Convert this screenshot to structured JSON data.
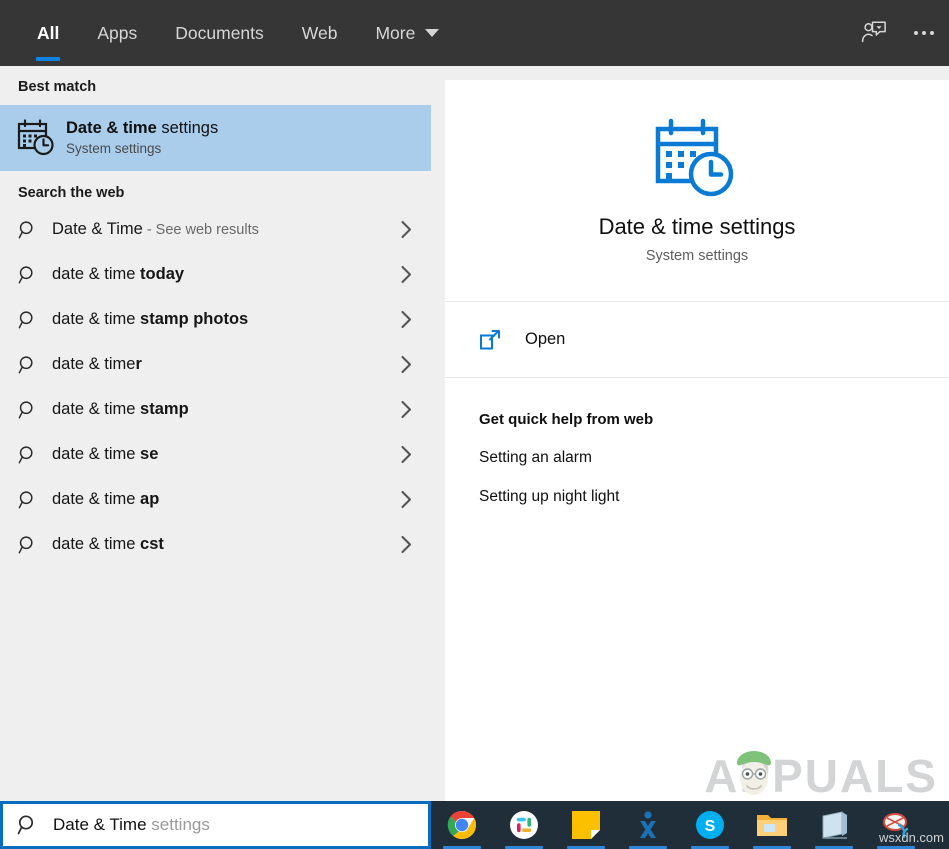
{
  "topbar": {
    "tabs": [
      {
        "label": "All",
        "active": true,
        "caret": false
      },
      {
        "label": "Apps",
        "active": false,
        "caret": false
      },
      {
        "label": "Documents",
        "active": false,
        "caret": false
      },
      {
        "label": "Web",
        "active": false,
        "caret": false
      },
      {
        "label": "More",
        "active": false,
        "caret": true
      }
    ],
    "feedback_icon": "feedback-person-icon",
    "overflow_icon": "ellipsis-icon",
    "accent_color": "#0a84e0",
    "background_color": "#363636"
  },
  "left_panel": {
    "best_match_heading": "Best match",
    "best_match": {
      "title_bold": "Date & time",
      "title_rest": " settings",
      "subtitle": "System settings",
      "icon": "calendar-clock-icon",
      "highlight_color": "#a9cdeb"
    },
    "web_heading": "Search the web",
    "suggestions": [
      {
        "prefix": "Date & Time",
        "bold": "",
        "suffix_muted": " - See web results"
      },
      {
        "prefix": "date & time ",
        "bold": "today",
        "suffix_muted": ""
      },
      {
        "prefix": "date & time ",
        "bold": "stamp photos",
        "suffix_muted": ""
      },
      {
        "prefix": "date & time",
        "bold": "r",
        "suffix_muted": ""
      },
      {
        "prefix": "date & time ",
        "bold": "stamp",
        "suffix_muted": ""
      },
      {
        "prefix": "date & time ",
        "bold": "se",
        "suffix_muted": ""
      },
      {
        "prefix": "date & time ",
        "bold": "ap",
        "suffix_muted": ""
      },
      {
        "prefix": "date & time ",
        "bold": "cst",
        "suffix_muted": ""
      }
    ]
  },
  "preview": {
    "icon": "calendar-clock-icon-large",
    "icon_color": "#0a7bd4",
    "title": "Date & time settings",
    "subtitle": "System settings",
    "open_action": {
      "label": "Open",
      "icon": "open-external-icon"
    },
    "help_title": "Get quick help from web",
    "help_links": [
      "Setting an alarm",
      "Setting up night light"
    ]
  },
  "search": {
    "typed_text": "Date & Time",
    "ghost_text": " settings",
    "icon": "search-icon",
    "border_color": "#0a6cbd"
  },
  "taskbar": {
    "background_color": "#1f2e38",
    "items": [
      {
        "name": "chrome",
        "running": true
      },
      {
        "name": "slack",
        "running": true
      },
      {
        "name": "sticky-notes",
        "running": true
      },
      {
        "name": "x-app",
        "running": true
      },
      {
        "name": "skype",
        "running": true
      },
      {
        "name": "file-explorer",
        "running": true
      },
      {
        "name": "calendar-app",
        "running": true
      },
      {
        "name": "paint-app",
        "running": true
      }
    ]
  },
  "watermarks": {
    "appuals": "APPUALS",
    "wsxdn": "wsxdn.com"
  }
}
